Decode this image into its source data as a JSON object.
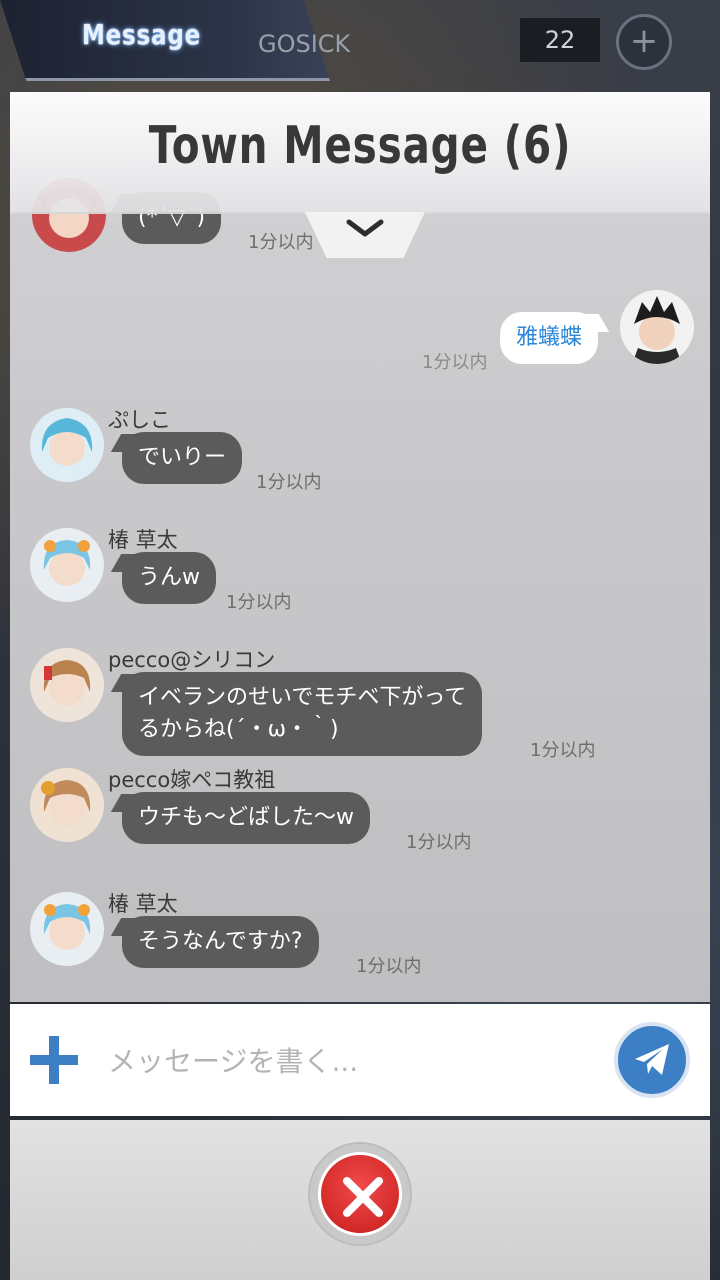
{
  "top_tab": {
    "label": "Message"
  },
  "hud": {
    "name": "GOSICK",
    "count": "22"
  },
  "panel": {
    "title": "Town Message (6)",
    "messages": [
      {
        "name": "",
        "text": "(*´▽`)",
        "time": "1分以内"
      },
      {
        "name": "",
        "text": "雅蟻蝶",
        "time": "1分以内",
        "mine": true
      },
      {
        "name": "ぷしこ",
        "text": "でいりー",
        "time": "1分以内"
      },
      {
        "name": "椿 草太",
        "text": "うんw",
        "time": "1分以内"
      },
      {
        "name": "pecco@シリコン",
        "text": "イベランのせいでモチベ下がって\nるからね(´・ω・｀)",
        "time": "1分以内"
      },
      {
        "name": "pecco嫁ペコ教祖",
        "text": "ウチも〜どばした〜w",
        "time": "1分以内"
      },
      {
        "name": "椿 草太",
        "text": "そうなんですか?",
        "time": "1分以内"
      }
    ]
  },
  "composer": {
    "placeholder": "メッセージを書く..."
  },
  "icons": {
    "plus": "plus-icon",
    "send": "paper-plane-icon",
    "close": "close-icon",
    "collapse": "chevron-down-icon"
  },
  "colors": {
    "accent_blue": "#3d7fc4",
    "close_red": "#d42a2a",
    "bubble_dark": "#5b5b5b",
    "my_text": "#2a86d6"
  }
}
